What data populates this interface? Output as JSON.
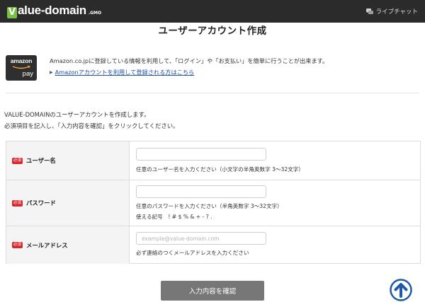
{
  "header": {
    "logo_mark": "V",
    "logo_text": "alue-domain",
    "logo_sub": ".GMO",
    "livechat_label": "ライブチャット",
    "livechat_icon": "chat-icon"
  },
  "page_title": "ユーザーアカウント作成",
  "amazon": {
    "badge_word": "amazon",
    "badge_pay": "pay",
    "description": "Amazon.co.jpに登録している情報を利用して、「ログイン」や「お支払い」を簡単に行うことが出来ます。",
    "link_text": "Amazonアカウントを利用して登録される方はこちら"
  },
  "intro": {
    "line1": "VALUE-DOMAINのユーザーアカウントを作成します。",
    "line2": "必須項目を記入し、「入力内容を確認」をクリックしてください。"
  },
  "form": {
    "required_badge": "必須",
    "username": {
      "label": "ユーザー名",
      "value": "",
      "placeholder": "",
      "hint": "任意のユーザー名を入力ください（小文字の半角英数字 3〜32文字）"
    },
    "password": {
      "label": "パスワード",
      "value": "",
      "placeholder": "",
      "hint": "任意のパスワードを入力ください（半角英数字 3〜32文字）",
      "hint2": "使える記号　! # $ % & + - ? ."
    },
    "email": {
      "label": "メールアドレス",
      "value": "",
      "placeholder": "example@value-domain.com",
      "hint": "必ず連絡のつくメールアドレスを入力ください"
    }
  },
  "submit_label": "入力内容を確認",
  "scroll_top_icon": "arrow-up-circle-icon",
  "colors": {
    "header_bg": "#2b2b2b",
    "logo_green": "#7ac143",
    "required_red": "#d8282f",
    "link_blue": "#1d4fa3",
    "submit_gray": "#777777",
    "scroll_top_blue": "#1f5aa8"
  }
}
